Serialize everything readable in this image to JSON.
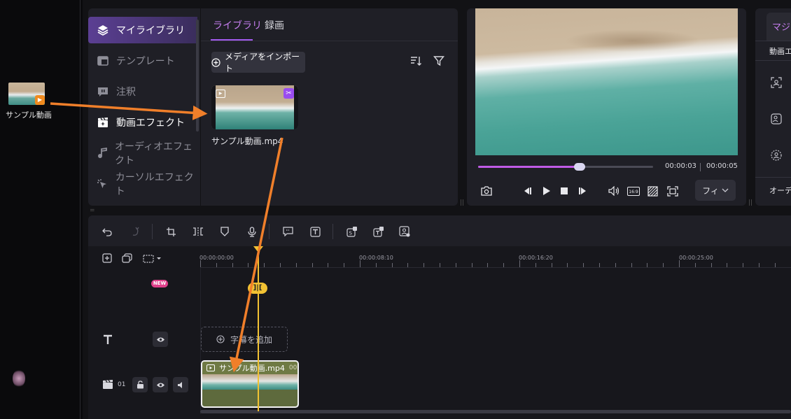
{
  "desktop": {
    "file_label": "サンプル動画"
  },
  "sidebar": {
    "items": [
      {
        "label": "マイライブラリ",
        "icon": "layers-icon"
      },
      {
        "label": "テンプレート",
        "icon": "template-icon"
      },
      {
        "label": "注釈",
        "icon": "annotation-icon"
      },
      {
        "label": "動画エフェクト",
        "icon": "video-effect-icon"
      },
      {
        "label": "オーディオエフェクト",
        "icon": "audio-effect-icon"
      },
      {
        "label": "カーソルエフェクト",
        "icon": "cursor-effect-icon"
      }
    ]
  },
  "library": {
    "tabs": [
      "ライブラリ",
      "録画"
    ],
    "import_label": "メディアをインポート",
    "clip_name": "サンプル動画.mp4"
  },
  "preview": {
    "current_time": "00:00:03",
    "total_time": "00:00:05",
    "progress": 0.58,
    "fit_label": "フィ",
    "aspect_label": "16:9"
  },
  "right_panel": {
    "tab_label": "マジ",
    "section_label": "動画エ",
    "footer_label": "オーディ"
  },
  "timeline": {
    "ruler_labels": [
      "00:00:00:00",
      "00:00:08:10",
      "00:00:16:20",
      "00:00:25:00"
    ],
    "new_badge": "NEW",
    "add_caption_label": "字幕を追加",
    "track_number": "01",
    "clip_label": "サンプル動画.mp4",
    "clip_suffix": "00",
    "split_label": "]|["
  },
  "colors": {
    "accent_purple": "#a45bf0",
    "playhead_yellow": "#f2c233",
    "arrow_orange": "#f07f2a"
  }
}
